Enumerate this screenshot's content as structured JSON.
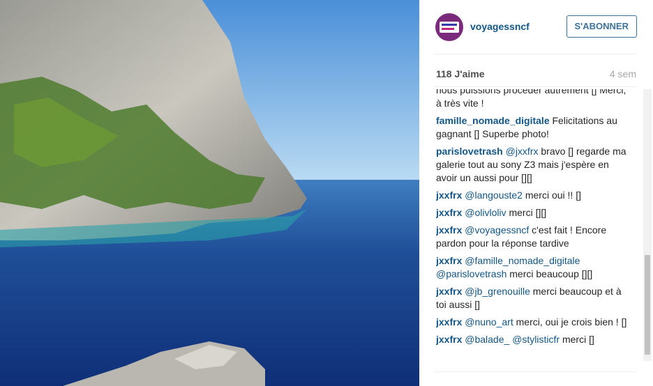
{
  "post": {
    "username": "voyagessncf",
    "follow_label": "S'ABONNER",
    "likes": "118 J'aime",
    "time": "4 sem"
  },
  "comments": [
    {
      "parts": [
        {
          "t": "text",
          "v": "nous puissions procéder autrement "
        },
        {
          "t": "text",
          "v": "[]"
        },
        {
          "t": "text",
          "v": " Merci, à très vite !"
        }
      ]
    },
    {
      "parts": [
        {
          "t": "author",
          "v": "famille_nomade_digitale"
        },
        {
          "t": "text",
          "v": " Felicitations au gagnant [] Superbe photo!"
        }
      ]
    },
    {
      "parts": [
        {
          "t": "author",
          "v": "parislovetrash"
        },
        {
          "t": "text",
          "v": " "
        },
        {
          "t": "mention",
          "v": "@jxxfrx"
        },
        {
          "t": "text",
          "v": " bravo [] regarde ma galerie tout au sony Z3 mais j'espère en avoir un aussi pour [][]"
        }
      ]
    },
    {
      "parts": [
        {
          "t": "author",
          "v": "jxxfrx"
        },
        {
          "t": "text",
          "v": " "
        },
        {
          "t": "mention",
          "v": "@langouste2"
        },
        {
          "t": "text",
          "v": " merci oui !! []"
        }
      ]
    },
    {
      "parts": [
        {
          "t": "author",
          "v": "jxxfrx"
        },
        {
          "t": "text",
          "v": " "
        },
        {
          "t": "mention",
          "v": "@olivloliv"
        },
        {
          "t": "text",
          "v": " merci [][]"
        }
      ]
    },
    {
      "parts": [
        {
          "t": "author",
          "v": "jxxfrx"
        },
        {
          "t": "text",
          "v": " "
        },
        {
          "t": "mention",
          "v": "@voyagessncf"
        },
        {
          "t": "text",
          "v": " c'est fait ! Encore pardon pour la réponse tardive"
        }
      ]
    },
    {
      "parts": [
        {
          "t": "author",
          "v": "jxxfrx"
        },
        {
          "t": "text",
          "v": " "
        },
        {
          "t": "mention",
          "v": "@famille_nomade_digitale"
        },
        {
          "t": "text",
          "v": " "
        },
        {
          "t": "mention",
          "v": "@parislovetrash"
        },
        {
          "t": "text",
          "v": " merci beaucoup [][]"
        }
      ]
    },
    {
      "parts": [
        {
          "t": "author",
          "v": "jxxfrx"
        },
        {
          "t": "text",
          "v": " "
        },
        {
          "t": "mention",
          "v": "@jb_grenouille"
        },
        {
          "t": "text",
          "v": " merci beaucoup et à toi aussi []"
        }
      ]
    },
    {
      "parts": [
        {
          "t": "author",
          "v": "jxxfrx"
        },
        {
          "t": "text",
          "v": " "
        },
        {
          "t": "mention",
          "v": "@nuno_art"
        },
        {
          "t": "text",
          "v": " merci, oui je crois bien ! []"
        }
      ]
    },
    {
      "parts": [
        {
          "t": "author",
          "v": "jxxfrx"
        },
        {
          "t": "text",
          "v": " "
        },
        {
          "t": "mention",
          "v": "@balade_"
        },
        {
          "t": "text",
          "v": " "
        },
        {
          "t": "mention",
          "v": "@stylisticfr"
        },
        {
          "t": "text",
          "v": " merci []"
        }
      ]
    }
  ],
  "colors": {
    "link": "#125688",
    "button": "#3f729b",
    "avatar": "#7b2a7b"
  }
}
